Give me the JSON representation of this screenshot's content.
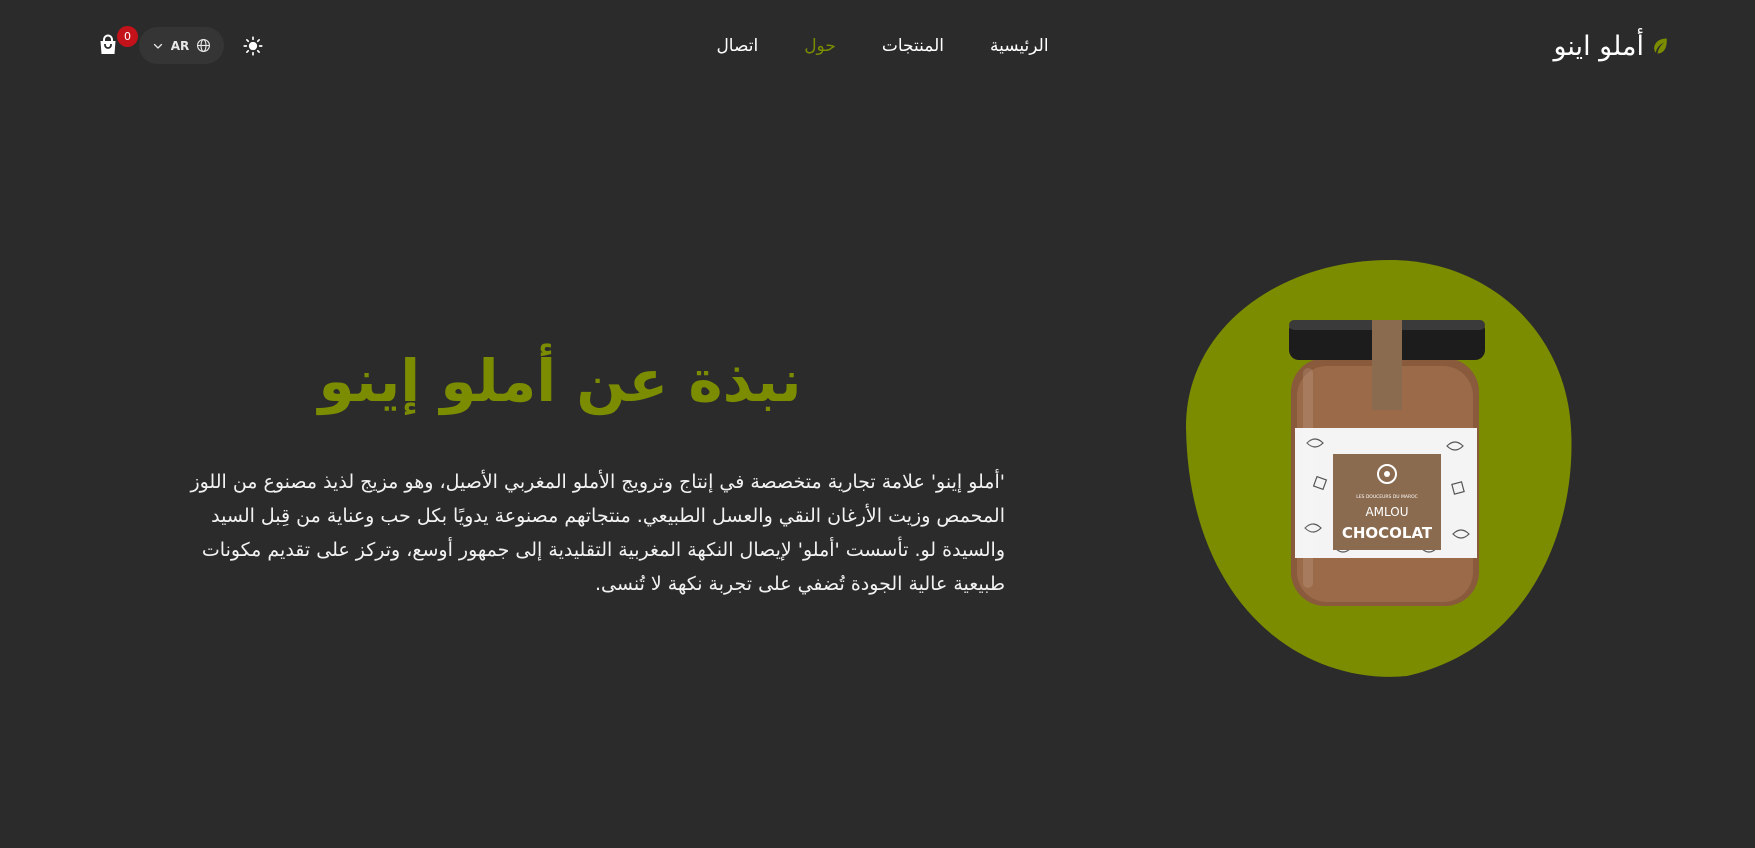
{
  "header": {
    "logo_text": "أملو اينو",
    "nav": [
      {
        "label": "الرئيسية",
        "active": false
      },
      {
        "label": "المنتجات",
        "active": false
      },
      {
        "label": "حول",
        "active": true
      },
      {
        "label": "اتصال",
        "active": false
      }
    ],
    "language": {
      "code": "AR"
    },
    "cart": {
      "count": "0"
    }
  },
  "main": {
    "title": "نبذة عن أملو إينو",
    "description": "'أملو إينو' علامة تجارية متخصصة في إنتاج وترويج الأملو المغربي الأصيل، وهو مزيج لذيذ مصنوع من اللوز المحمص وزيت الأرغان النقي والعسل الطبيعي. منتجاتهم مصنوعة يدويًا بكل حب وعناية من قِبل السيد والسيدة لو. تأسست 'أملو' لإيصال النكهة المغربية التقليدية إلى جمهور أوسع، وتركز على تقديم مكونات طبيعية عالية الجودة تُضفي على تجربة نكهة لا تُنسى.",
    "product_label": {
      "brand": "LES DOUCEURS DU MAROC",
      "line1": "AMLOU",
      "line2": "CHOCOLAT"
    }
  },
  "colors": {
    "background": "#2b2b2b",
    "accent": "#7b8c00",
    "badge": "#c4121a"
  },
  "icons": [
    "leaf-icon",
    "sun-icon",
    "globe-icon",
    "chevron-down-icon",
    "shopping-bag-icon"
  ]
}
